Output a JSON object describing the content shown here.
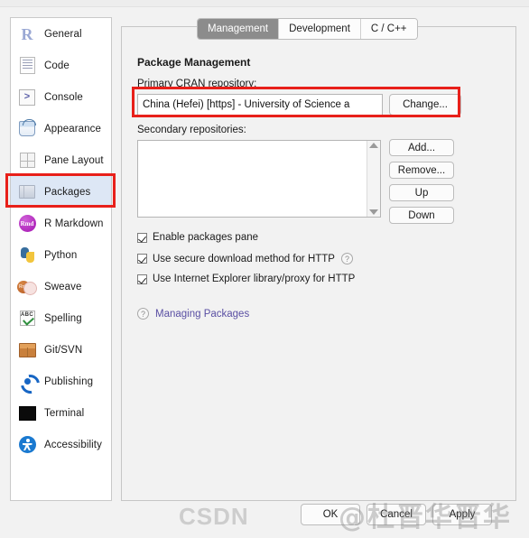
{
  "sidebar": {
    "items": [
      {
        "label": "General",
        "icon": "r-logo-icon",
        "selected": false
      },
      {
        "label": "Code",
        "icon": "code-document-icon",
        "selected": false
      },
      {
        "label": "Console",
        "icon": "console-prompt-icon",
        "selected": false
      },
      {
        "label": "Appearance",
        "icon": "paint-bucket-icon",
        "selected": false
      },
      {
        "label": "Pane Layout",
        "icon": "pane-grid-icon",
        "selected": false
      },
      {
        "label": "Packages",
        "icon": "package-box-icon",
        "selected": true
      },
      {
        "label": "R Markdown",
        "icon": "rmd-badge-icon",
        "selected": false
      },
      {
        "label": "Python",
        "icon": "python-logo-icon",
        "selected": false
      },
      {
        "label": "Sweave",
        "icon": "sweave-pdf-icon",
        "selected": false
      },
      {
        "label": "Spelling",
        "icon": "spellcheck-abc-icon",
        "selected": false
      },
      {
        "label": "Git/SVN",
        "icon": "cardboard-box-icon",
        "selected": false
      },
      {
        "label": "Publishing",
        "icon": "publish-share-icon",
        "selected": false
      },
      {
        "label": "Terminal",
        "icon": "terminal-black-icon",
        "selected": false
      },
      {
        "label": "Accessibility",
        "icon": "accessibility-icon",
        "selected": false
      }
    ]
  },
  "tabs": [
    {
      "label": "Management",
      "active": true
    },
    {
      "label": "Development",
      "active": false
    },
    {
      "label": "C / C++",
      "active": false
    }
  ],
  "main": {
    "section_title": "Package Management",
    "primary_label": "Primary CRAN repository:",
    "primary_value": "China (Hefei) [https] - University of Science a",
    "change_button": "Change...",
    "secondary_label": "Secondary repositories:",
    "secondary_items": [],
    "list_buttons": [
      "Add...",
      "Remove...",
      "Up",
      "Down"
    ],
    "checkboxes": [
      {
        "label": "Enable packages pane",
        "checked": true,
        "help": false
      },
      {
        "label": "Use secure download method for HTTP",
        "checked": true,
        "help": true
      },
      {
        "label": "Use Internet Explorer library/proxy for HTTP",
        "checked": true,
        "help": false
      }
    ],
    "help_link": "Managing Packages",
    "help_icon": "question-mark-icon"
  },
  "footer": {
    "ok": "OK",
    "cancel": "Cancel",
    "apply": "Apply"
  },
  "watermark": {
    "brand": "CSDN",
    "handle": "@杜晋华晋华"
  },
  "colors": {
    "annotation_red": "#e8201a",
    "selection_blue": "#dde7f5",
    "active_tab_gray": "#8c8c8c",
    "link_purple": "#5a4fa3"
  }
}
